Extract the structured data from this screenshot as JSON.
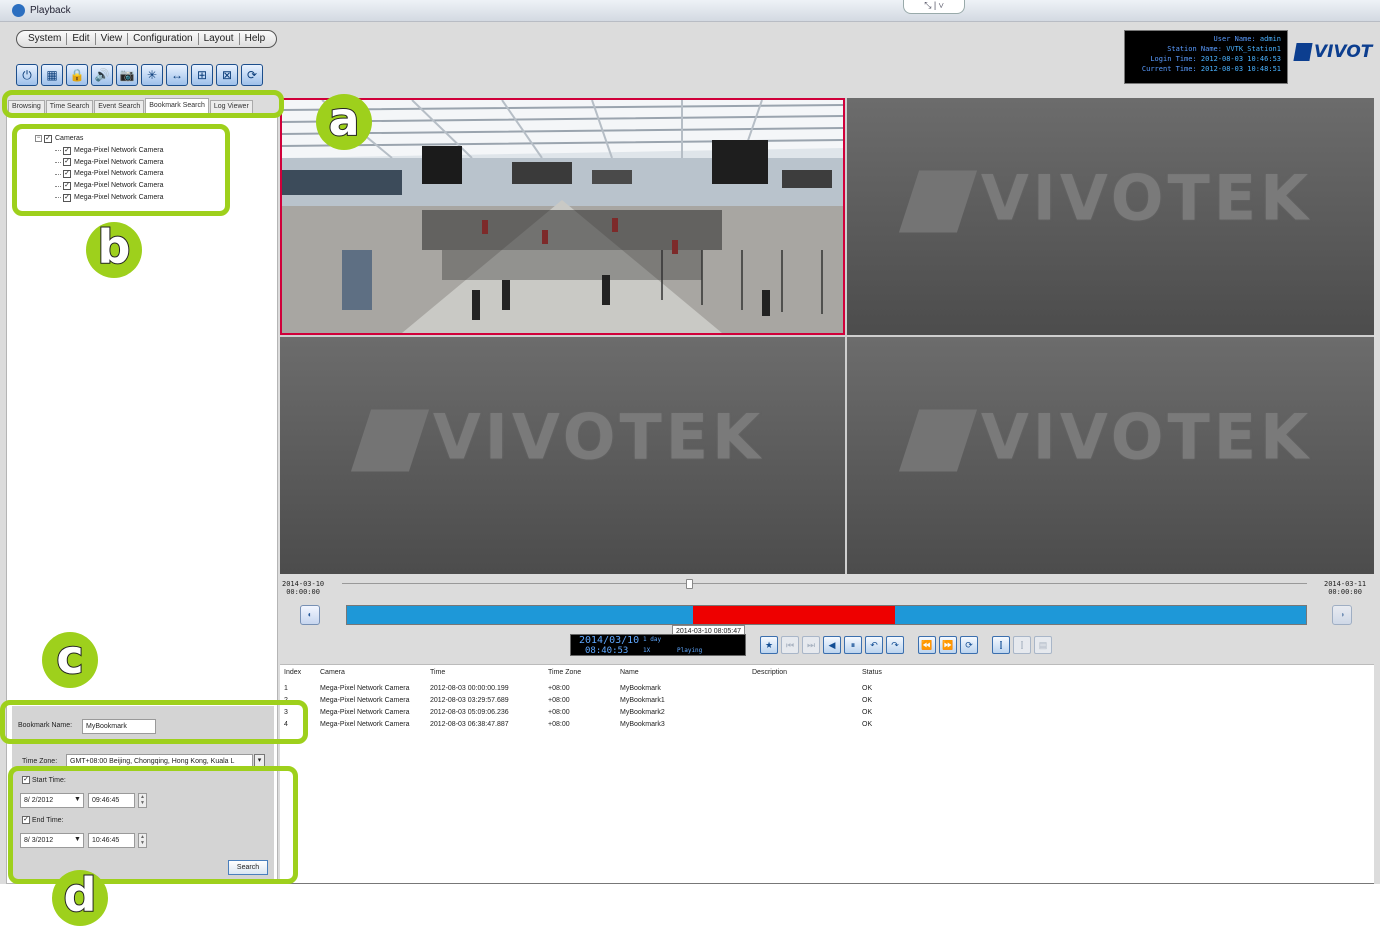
{
  "window": {
    "title": "Playback",
    "controls": "⤡ | ∨"
  },
  "menu": [
    "System",
    "Edit",
    "View",
    "Configuration",
    "Layout",
    "Help"
  ],
  "toolbar": {
    "icons": [
      "power-icon",
      "layout-icon",
      "lock-icon",
      "audio-icon",
      "snapshot-icon",
      "ptz-icon",
      "export-icon",
      "fullscreen-icon",
      "patrol-icon",
      "sync-icon"
    ],
    "glyphs": [
      "⏻",
      "▦",
      "🔒",
      "🔊",
      "📷",
      "✳",
      "↔",
      "⊞",
      "⊠",
      "⟳"
    ]
  },
  "session": {
    "user_label": "User Name:",
    "user": "admin",
    "station_label": "Station Name:",
    "station": "VVTK_Station1",
    "login_label": "Login Time:",
    "login_time": "2012-08-03 10:46:53",
    "current_label": "Current Time:",
    "current_time": "2012-08-03 10:48:51"
  },
  "logo": "VIVOT",
  "tabs": [
    "Browsing",
    "Time Search",
    "Event Search",
    "Bookmark Search",
    "Log Viewer"
  ],
  "active_tab": "Bookmark Search",
  "tree": {
    "root_label": "Cameras",
    "cameras": [
      "Mega-Pixel Network Camera",
      "Mega-Pixel Network Camera",
      "Mega-Pixel Network Camera",
      "Mega-Pixel Network Camera",
      "Mega-Pixel Network Camera"
    ]
  },
  "filters": {
    "bookmark_name_label": "Bookmark Name:",
    "bookmark_name_value": "MyBookmark",
    "time_zone_label": "Time Zone:",
    "time_zone_value": "GMT+08:00 Beijing, Chongqing, Hong Kong, Kuala L",
    "start_label": "Start Time:",
    "start_date": "8/ 2/2012",
    "start_time": "09:46:45",
    "end_label": "End Time:",
    "end_date": "8/ 3/2012",
    "end_time": "10:46:45",
    "search_label": "Search"
  },
  "video": {
    "watermark": "VIVOTEK"
  },
  "playback": {
    "start_date": "2014-03-10",
    "start_time": "00:00:00",
    "end_date": "2014-03-11",
    "end_time": "00:00:00",
    "slider_position": 0.36,
    "bookmark_segment": {
      "start": 0.361,
      "end": 0.571
    },
    "tooltip": "2014-03-10 08:05:47",
    "lcd_date": "2014/03/10",
    "lcd_time": "08:40:53",
    "lcd_range": "1 day",
    "lcd_speed": "1X",
    "lcd_state": "Playing",
    "controls": [
      "★",
      "⏮",
      "⏭",
      "◀",
      "⏸",
      "↶",
      "↷",
      "⏪",
      "⏩",
      "⟳"
    ]
  },
  "results": {
    "columns": [
      "Index",
      "Camera",
      "Time",
      "Time Zone",
      "Name",
      "Description",
      "Status"
    ],
    "rows": [
      [
        "1",
        "Mega-Pixel Network Camera",
        "2012-08-03 00:00:00.199",
        "+08:00",
        "MyBookmark",
        "",
        "OK"
      ],
      [
        "2",
        "Mega-Pixel Network Camera",
        "2012-08-03 03:29:57.689",
        "+08:00",
        "MyBookmark1",
        "",
        "OK"
      ],
      [
        "3",
        "Mega-Pixel Network Camera",
        "2012-08-03 05:09:06.236",
        "+08:00",
        "MyBookmark2",
        "",
        "OK"
      ],
      [
        "4",
        "Mega-Pixel Network Camera",
        "2012-08-03 06:38:47.887",
        "+08:00",
        "MyBookmark3",
        "",
        "OK"
      ]
    ]
  },
  "callouts": [
    "a",
    "b",
    "c",
    "d"
  ],
  "colors": {
    "callout": "#9ed01c",
    "timeline_blue": "#1e98d8",
    "bookmark_red": "#ee0000",
    "selected_border": "#d0003a"
  }
}
